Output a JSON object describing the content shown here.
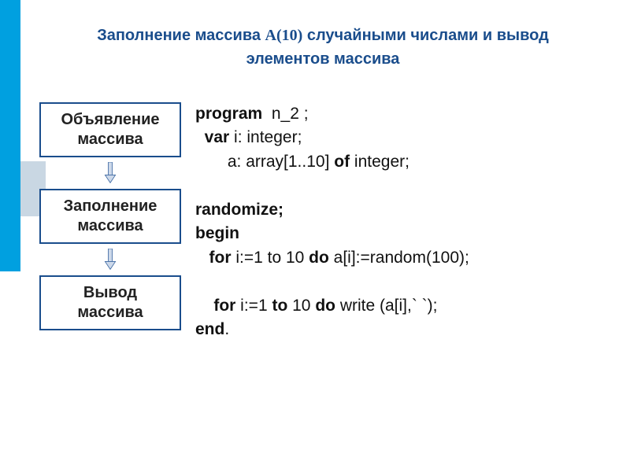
{
  "title": {
    "line1_before": "Заполнение массива ",
    "line1_formula": "A(10)",
    "line1_after": " случайными числами и вывод",
    "line2": "элементов массива"
  },
  "flow": {
    "box1_l1": "Объявление",
    "box1_l2": "массива",
    "box2_l1": "Заполнение",
    "box2_l2": "массива",
    "box3_l1": "Вывод",
    "box3_l2": "массива"
  },
  "code": {
    "l1_kw": "program",
    "l1_rest": "  n_2 ;",
    "l2_pre": "  ",
    "l2_kw": "var",
    "l2_rest": " i: integer;",
    "l3": "       a: array[1..10] ",
    "l3_kw": "of",
    "l3_rest": " integer;",
    "l4": "randomize;",
    "l5": "begin",
    "l6_pre": "   ",
    "l6_for": "for",
    "l6_mid": " i:=1 to 10 ",
    "l6_do": "do",
    "l6_rest": " a[i]:=random(100);",
    "l7_pre": "    ",
    "l7_for": "for",
    "l7_mid1": " i:=1 ",
    "l7_to": "to",
    "l7_mid2": " 10 ",
    "l7_do": "do",
    "l7_rest": " write (a[i],` `);",
    "l8": "end",
    "l8_dot": "."
  }
}
